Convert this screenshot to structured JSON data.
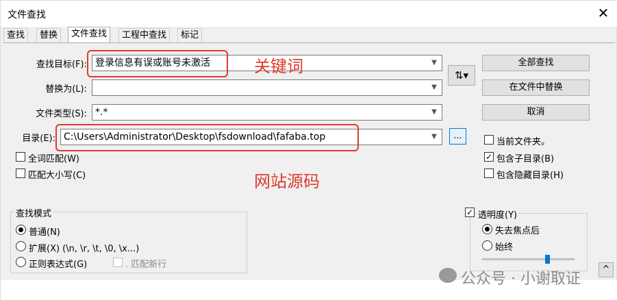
{
  "window": {
    "title": "文件查找",
    "close_label": "✕"
  },
  "tabs": [
    "查找",
    "替换",
    "文件查找",
    "工程中查找",
    "标记"
  ],
  "fields": {
    "find_label": "查找目标(F):",
    "find_value": "登录信息有误或账号未激活",
    "replace_label": "替换为(L):",
    "replace_value": "",
    "filetype_label": "文件类型(S):",
    "filetype_value": "*.*",
    "dir_label": "目录(E):",
    "dir_value": "C:\\Users\\Administrator\\Desktop\\fsdownload\\fafaba.top",
    "browse_label": "..."
  },
  "swap_button": "⇅▾",
  "buttons": {
    "find_all": "全部查找",
    "replace_in_files": "在文件中替换",
    "cancel": "取消"
  },
  "options_left": [
    {
      "label": "全词匹配(W)",
      "checked": false
    },
    {
      "label": "匹配大小写(C)",
      "checked": false
    }
  ],
  "options_right": [
    {
      "label": "当前文件夹。",
      "checked": false
    },
    {
      "label": "包含子目录(B)",
      "checked": true
    },
    {
      "label": "包含隐藏目录(H)",
      "checked": false
    }
  ],
  "search_mode": {
    "title": "查找模式",
    "options": [
      {
        "label": "普通(N)",
        "selected": true
      },
      {
        "label": "扩展(X) (\\n, \\r, \\t, \\0, \\x...)",
        "selected": false
      },
      {
        "label": "正则表达式(G)",
        "selected": false
      }
    ],
    "match_newline": ". 匹配新行"
  },
  "transparency": {
    "label": "透明度(Y)",
    "checked": true,
    "options": [
      {
        "label": "失去焦点后",
        "selected": true
      },
      {
        "label": "始终",
        "selected": false
      }
    ],
    "slider_level_pct": 70
  },
  "collapse_button": "^",
  "annotations": {
    "keyword": "关键词",
    "source": "网站源码"
  },
  "watermark": "公众号 · 小谢取证"
}
